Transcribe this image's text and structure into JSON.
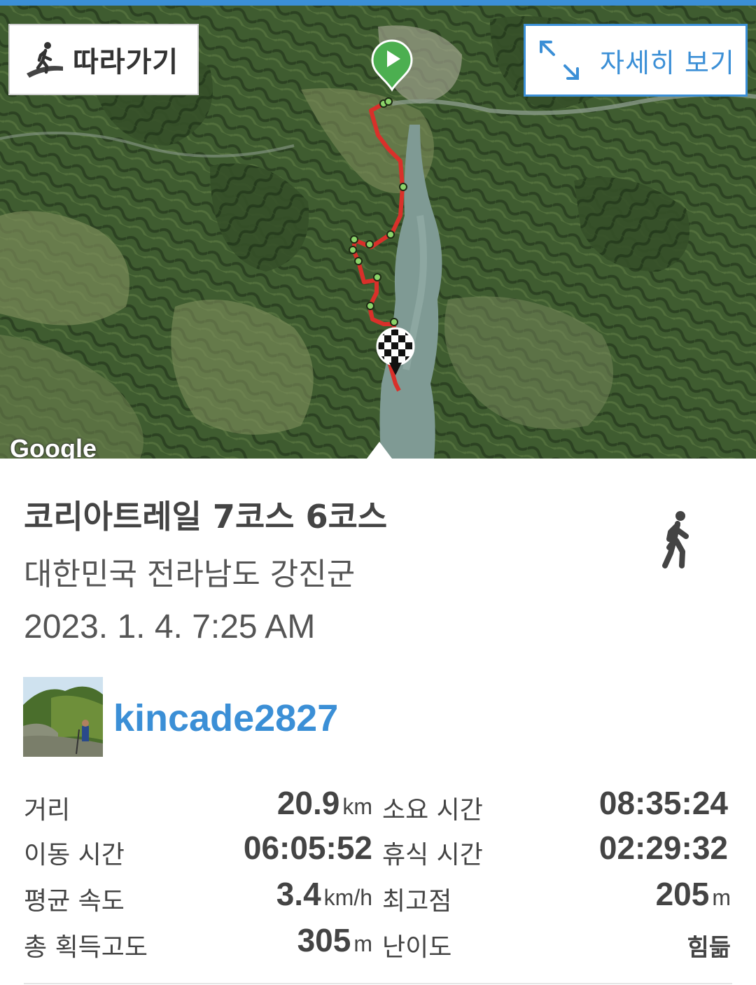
{
  "map": {
    "follow_label": "따라가기",
    "detail_label": "자세히 보기",
    "attribution": "Google"
  },
  "activity": {
    "title": "코리아트레일 7코스 6코스",
    "location": "대한민국 전라남도 강진군",
    "datetime": "2023. 1. 4. 7:25 AM",
    "activity_type_icon": "walking-person-icon",
    "username": "kincade2827"
  },
  "stats": {
    "distance": {
      "label": "거리",
      "value": "20.9",
      "unit": "km"
    },
    "total_time": {
      "label": "소요 시간",
      "value": "08:35:24"
    },
    "moving_time": {
      "label": "이동 시간",
      "value": "06:05:52"
    },
    "rest_time": {
      "label": "휴식 시간",
      "value": "02:29:32"
    },
    "avg_speed": {
      "label": "평균 속도",
      "value": "3.4",
      "unit": "km/h"
    },
    "max_elevation": {
      "label": "최고점",
      "value": "205",
      "unit": "m"
    },
    "total_ascent": {
      "label": "총 획득고도",
      "value": "305",
      "unit": "m"
    },
    "difficulty": {
      "label": "난이도",
      "value": "힘듦"
    }
  },
  "colors": {
    "accent": "#3b8fd6",
    "route": "#d9302a",
    "start_marker": "#4caf50"
  }
}
